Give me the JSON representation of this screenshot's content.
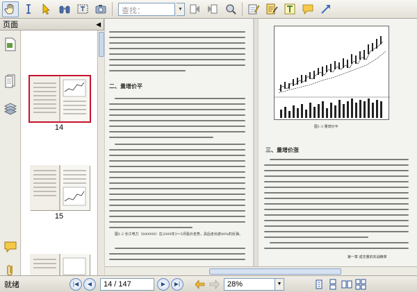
{
  "toolbar": {
    "search_placeholder": "查找：",
    "icons": [
      "hand-tool-icon",
      "text-select-icon",
      "pointer-icon",
      "find-binoculars-icon",
      "text-box-select-icon",
      "snapshot-camera-icon",
      "previous-search-icon",
      "next-search-icon",
      "magnifier-icon",
      "highlight-icon",
      "note-edit-icon",
      "text-tool-icon",
      "comment-icon",
      "arrow-tool-icon"
    ]
  },
  "panel": {
    "title": "页面",
    "thumbnails": [
      {
        "number": "14",
        "selected": true
      },
      {
        "number": "15",
        "selected": false
      }
    ]
  },
  "document": {
    "left_page": {
      "heading_2": "二、量增价平",
      "caption_1": "图1-2 长江电力（600900）在2009年3～5月股价走势，具后走出波40%的反弹。"
    },
    "right_page": {
      "figure_caption": "图1-3 量增价平",
      "heading_3": "三、量增价涨",
      "footer": "第一章 成交量的实战精萃"
    }
  },
  "status": {
    "text": "就绪",
    "page_value": "14 / 147",
    "zoom_value": "28%"
  }
}
